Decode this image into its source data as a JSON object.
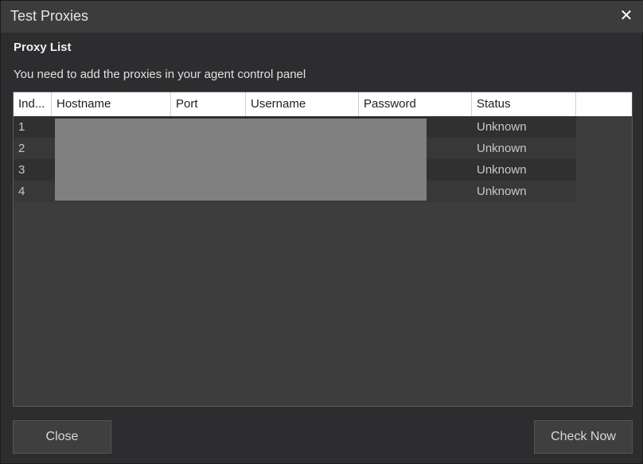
{
  "dialog": {
    "title": "Test Proxies",
    "close_glyph": "✕"
  },
  "section": {
    "title": "Proxy List",
    "info": "You need to add the proxies in your agent control panel"
  },
  "table": {
    "columns": [
      "Ind...",
      "Hostname",
      "Port",
      "Username",
      "Password",
      "Status"
    ],
    "rows": [
      {
        "index": "1",
        "status": "Unknown"
      },
      {
        "index": "2",
        "status": "Unknown"
      },
      {
        "index": "3",
        "status": "Unknown"
      },
      {
        "index": "4",
        "status": "Unknown"
      }
    ]
  },
  "buttons": {
    "close": "Close",
    "check_now": "Check Now"
  },
  "icons": {
    "close": "close-icon"
  }
}
